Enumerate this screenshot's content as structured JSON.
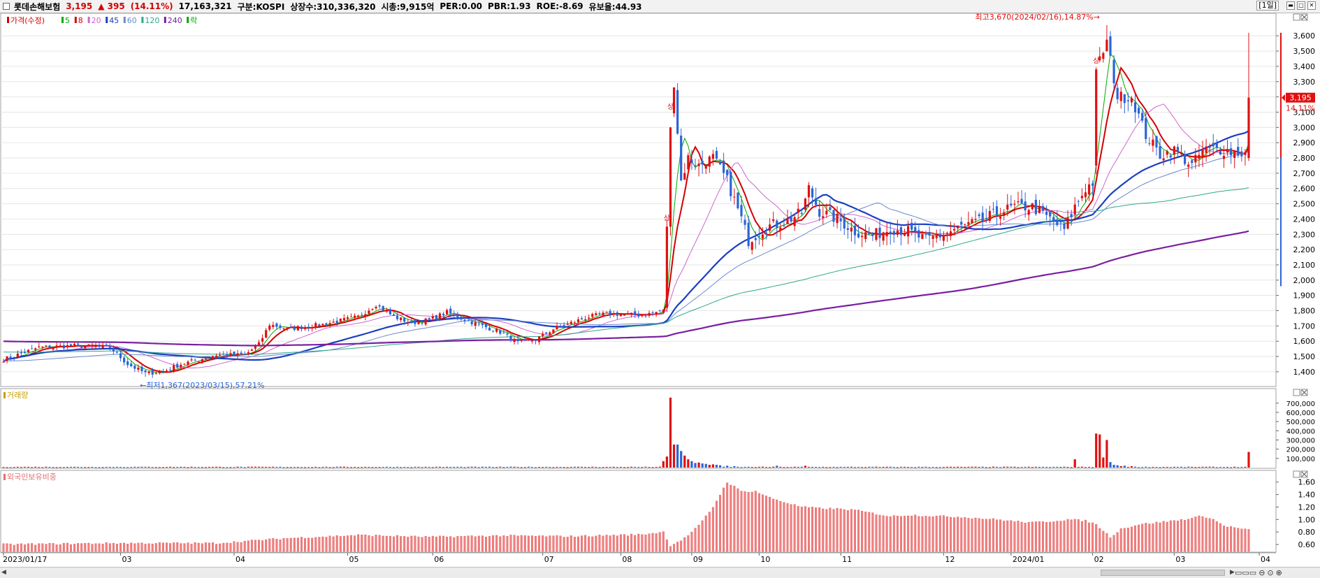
{
  "header": {
    "stock_name": "롯데손해보험",
    "price": "3,195",
    "change": "▲ 395",
    "change_pct": "(14.11%)",
    "volume": "17,163,321",
    "market": "구분:KOSPI",
    "shares": "상장수:310,336,320",
    "mktcap": "시총:9,915억",
    "per": "PER:0.00",
    "pbr": "PBR:1.93",
    "roe": "ROE:-8.69",
    "float": "유보율:44.93",
    "period": "[1일]"
  },
  "price_panel": {
    "legend": [
      {
        "label": "가격(수정)",
        "color": "#d40000"
      },
      {
        "label": "5",
        "color": "#00aa00"
      },
      {
        "label": "8",
        "color": "#d40000"
      },
      {
        "label": "20",
        "color": "#cc66cc"
      },
      {
        "label": "45",
        "color": "#1a3fbf"
      },
      {
        "label": "60",
        "color": "#6a88d0"
      },
      {
        "label": "120",
        "color": "#2ea88c"
      },
      {
        "label": "240",
        "color": "#7a1fa0"
      },
      {
        "label": "락",
        "color": "#00aa00"
      }
    ],
    "high_label": "최고3,670(2024/02/16),14.87%→",
    "low_label": "←최저1,367(2023/03/15),57.21%",
    "current_price_tag": "3,195",
    "current_pct_tag": "14.11%",
    "limit_up_mark": "상"
  },
  "volume_panel": {
    "title": "거래량",
    "color": "#c8a000"
  },
  "foreign_panel": {
    "title": "외국인보유비중",
    "color": "#e07070"
  },
  "x_axis_labels": [
    "2023/01/17",
    "03",
    "04",
    "05",
    "06",
    "07",
    "08",
    "09",
    "10",
    "11",
    "12",
    "2024/01",
    "02",
    "03",
    "04"
  ],
  "colors": {
    "up": "#e01010",
    "down": "#2a64d8",
    "grid": "#e6e6e6",
    "border": "#a0a0a0"
  },
  "chart_data": [
    {
      "type": "candlestick",
      "title": "가격(수정)",
      "ylim": [
        1340,
        3720
      ],
      "yticks": [
        1400,
        1500,
        1600,
        1700,
        1800,
        1900,
        2000,
        2100,
        2200,
        2300,
        2400,
        2500,
        2600,
        2700,
        2800,
        2900,
        3000,
        3100,
        3200,
        3300,
        3400,
        3500,
        3600
      ],
      "anchors": [
        [
          0,
          1480
        ],
        [
          10,
          1560
        ],
        [
          20,
          1570
        ],
        [
          30,
          1560
        ],
        [
          35,
          1450
        ],
        [
          40,
          1390
        ],
        [
          45,
          1400
        ],
        [
          50,
          1450
        ],
        [
          60,
          1510
        ],
        [
          68,
          1510
        ],
        [
          72,
          1580
        ],
        [
          75,
          1710
        ],
        [
          80,
          1680
        ],
        [
          90,
          1710
        ],
        [
          100,
          1760
        ],
        [
          105,
          1840
        ],
        [
          110,
          1760
        ],
        [
          115,
          1720
        ],
        [
          120,
          1740
        ],
        [
          125,
          1790
        ],
        [
          130,
          1740
        ],
        [
          135,
          1700
        ],
        [
          140,
          1660
        ],
        [
          145,
          1590
        ],
        [
          150,
          1610
        ],
        [
          155,
          1680
        ],
        [
          160,
          1720
        ],
        [
          165,
          1760
        ],
        [
          170,
          1780
        ],
        [
          180,
          1770
        ],
        [
          186,
          1800
        ],
        [
          187,
          2350
        ],
        [
          188,
          3050
        ],
        [
          189,
          3300
        ],
        [
          191,
          2650
        ],
        [
          193,
          2800
        ],
        [
          196,
          2750
        ],
        [
          200,
          2800
        ],
        [
          204,
          2650
        ],
        [
          208,
          2400
        ],
        [
          210,
          2260
        ],
        [
          215,
          2350
        ],
        [
          220,
          2380
        ],
        [
          225,
          2440
        ],
        [
          227,
          2600
        ],
        [
          230,
          2450
        ],
        [
          235,
          2400
        ],
        [
          240,
          2320
        ],
        [
          245,
          2290
        ],
        [
          250,
          2340
        ],
        [
          255,
          2320
        ],
        [
          260,
          2260
        ],
        [
          265,
          2300
        ],
        [
          270,
          2350
        ],
        [
          275,
          2380
        ],
        [
          280,
          2440
        ],
        [
          285,
          2480
        ],
        [
          290,
          2480
        ],
        [
          295,
          2400
        ],
        [
          299,
          2330
        ],
        [
          302,
          2480
        ],
        [
          305,
          2600
        ],
        [
          307,
          2640
        ],
        [
          308,
          3380
        ],
        [
          311,
          3560
        ],
        [
          314,
          3200
        ],
        [
          318,
          3200
        ],
        [
          322,
          2950
        ],
        [
          326,
          2820
        ],
        [
          330,
          2850
        ],
        [
          335,
          2750
        ],
        [
          338,
          2850
        ],
        [
          342,
          2860
        ],
        [
          346,
          2840
        ],
        [
          350,
          2830
        ]
      ],
      "highlight_candle": {
        "index": 351,
        "open": 2800,
        "high": 3620,
        "low": 2780,
        "close": 3195
      },
      "high": {
        "value": 3670,
        "date": "2024/02/16",
        "index": 311
      },
      "low": {
        "value": 1367,
        "date": "2023/03/15",
        "index": 40
      },
      "moving_averages": [
        5,
        8,
        20,
        45,
        60,
        120,
        240
      ]
    },
    {
      "type": "bar",
      "title": "거래량",
      "ylim": [
        0,
        820000
      ],
      "yticks": [
        100000,
        200000,
        300000,
        400000,
        500000,
        600000,
        700000
      ],
      "spikes": [
        {
          "i": 186,
          "v": 70000
        },
        {
          "i": 187,
          "v": 120000
        },
        {
          "i": 188,
          "v": 760000
        },
        {
          "i": 189,
          "v": 250000
        },
        {
          "i": 190,
          "v": 250000
        },
        {
          "i": 191,
          "v": 180000
        },
        {
          "i": 192,
          "v": 130000
        },
        {
          "i": 193,
          "v": 90000
        },
        {
          "i": 194,
          "v": 70000
        },
        {
          "i": 195,
          "v": 50000
        },
        {
          "i": 196,
          "v": 55000
        },
        {
          "i": 197,
          "v": 45000
        },
        {
          "i": 198,
          "v": 40000
        },
        {
          "i": 199,
          "v": 30000
        },
        {
          "i": 200,
          "v": 35000
        },
        {
          "i": 201,
          "v": 30000
        },
        {
          "i": 202,
          "v": 25000
        },
        {
          "i": 204,
          "v": 20000
        },
        {
          "i": 206,
          "v": 15000
        },
        {
          "i": 218,
          "v": 20000
        },
        {
          "i": 226,
          "v": 20000
        },
        {
          "i": 302,
          "v": 90000
        },
        {
          "i": 308,
          "v": 370000
        },
        {
          "i": 309,
          "v": 360000
        },
        {
          "i": 310,
          "v": 110000
        },
        {
          "i": 311,
          "v": 300000
        },
        {
          "i": 312,
          "v": 60000
        },
        {
          "i": 313,
          "v": 30000
        },
        {
          "i": 314,
          "v": 25000
        },
        {
          "i": 315,
          "v": 15000
        },
        {
          "i": 316,
          "v": 20000
        },
        {
          "i": 318,
          "v": 15000
        },
        {
          "i": 351,
          "v": 170000
        }
      ]
    },
    {
      "type": "bar",
      "title": "외국인보유비중",
      "ylim": [
        0.5,
        1.72
      ],
      "yticks": [
        0.6,
        0.8,
        1.0,
        1.2,
        1.4,
        1.6
      ],
      "anchors": [
        [
          0,
          0.6
        ],
        [
          30,
          0.62
        ],
        [
          60,
          0.62
        ],
        [
          80,
          0.7
        ],
        [
          100,
          0.75
        ],
        [
          120,
          0.72
        ],
        [
          140,
          0.74
        ],
        [
          160,
          0.73
        ],
        [
          180,
          0.76
        ],
        [
          186,
          0.8
        ],
        [
          188,
          0.58
        ],
        [
          192,
          0.7
        ],
        [
          196,
          0.9
        ],
        [
          200,
          1.2
        ],
        [
          202,
          1.4
        ],
        [
          204,
          1.6
        ],
        [
          208,
          1.45
        ],
        [
          212,
          1.45
        ],
        [
          216,
          1.35
        ],
        [
          220,
          1.28
        ],
        [
          225,
          1.2
        ],
        [
          230,
          1.18
        ],
        [
          235,
          1.17
        ],
        [
          240,
          1.15
        ],
        [
          245,
          1.1
        ],
        [
          250,
          1.05
        ],
        [
          255,
          1.07
        ],
        [
          260,
          1.06
        ],
        [
          265,
          1.05
        ],
        [
          270,
          1.04
        ],
        [
          275,
          1.02
        ],
        [
          280,
          1.0
        ],
        [
          285,
          0.97
        ],
        [
          290,
          0.95
        ],
        [
          295,
          0.97
        ],
        [
          300,
          1.0
        ],
        [
          305,
          0.98
        ],
        [
          308,
          0.92
        ],
        [
          312,
          0.72
        ],
        [
          315,
          0.85
        ],
        [
          320,
          0.92
        ],
        [
          325,
          0.95
        ],
        [
          330,
          0.98
        ],
        [
          335,
          1.02
        ],
        [
          338,
          1.06
        ],
        [
          341,
          1.0
        ],
        [
          344,
          0.9
        ],
        [
          348,
          0.86
        ],
        [
          351,
          0.83
        ]
      ]
    }
  ]
}
